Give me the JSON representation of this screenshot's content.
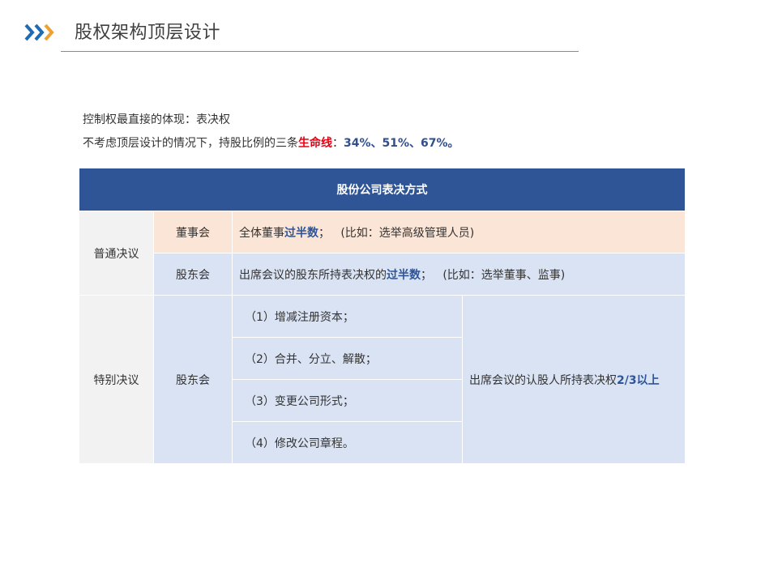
{
  "header": {
    "title": "股权架构顶层设计",
    "icon": "chevron-arrows-icon",
    "colors": {
      "blue": "#1f6bb5",
      "orange": "#f0a030"
    }
  },
  "intro": {
    "line1": "控制权最直接的体现：表决权",
    "line2_prefix": "不考虑顶层设计的情况下，持股比例的三条",
    "line2_emph": "生命线",
    "line2_colon": "：",
    "line2_values": "34%、51%、67%。"
  },
  "table": {
    "header": "股份公司表决方式",
    "ordinary": {
      "category": "普通决议",
      "board": {
        "body": "董事会",
        "text_prefix": "全体董事",
        "text_emph": "过半数",
        "text_suffix": "；   (比如：选举高级管理人员)"
      },
      "shareholders": {
        "body": "股东会",
        "text_prefix": "出席会议的股东所持表决权的",
        "text_emph": "过半数",
        "text_suffix": "；   (比如：选举董事、监事)"
      }
    },
    "special": {
      "category": "特别决议",
      "body": "股东会",
      "items": [
        "（1）增减注册资本；",
        "（2）合并、分立、解散；",
        "（3）变更公司形式；",
        "（4）修改公司章程。"
      ],
      "rule_prefix": "出席会议的认股人所持表决权",
      "rule_emph": "2/3以上"
    }
  },
  "colors": {
    "header_bg": "#2f5597",
    "peach": "#fbe5d6",
    "lavender": "#dae3f3",
    "gray": "#f2f2f2",
    "red": "#e60012"
  }
}
